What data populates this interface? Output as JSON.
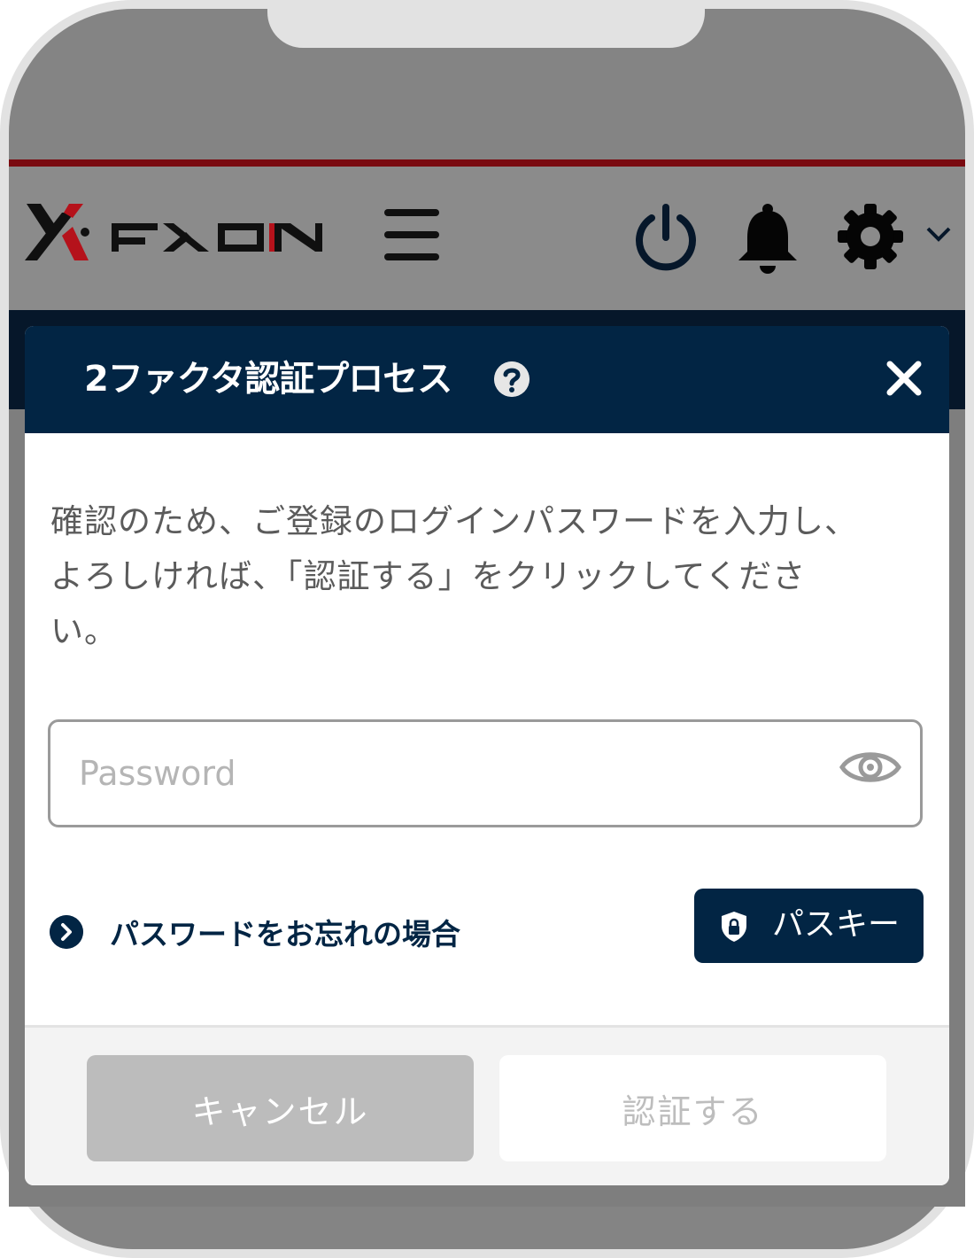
{
  "header": {
    "logo_text": "FXON",
    "icons": [
      "menu-icon",
      "power-icon",
      "bell-icon",
      "gear-icon",
      "chevron-down-icon"
    ]
  },
  "modal": {
    "title": "2ファクタ認証プロセス",
    "description_lines": [
      "確認のため、ご登録のログインパスワードを入力し、",
      "よろしければ、「認証する」をクリックしてくださ",
      "い。"
    ],
    "password": {
      "placeholder": "Password",
      "value": ""
    },
    "forgot_link": "パスワードをお忘れの場合",
    "passkey_button": "パスキー",
    "cancel_button": "キャンセル",
    "confirm_button": "認証する"
  },
  "colors": {
    "brand_navy": "#022544",
    "accent_red": "#c1121f",
    "overlay_gray": "#848484",
    "disabled_gray": "#bcbcbc"
  }
}
